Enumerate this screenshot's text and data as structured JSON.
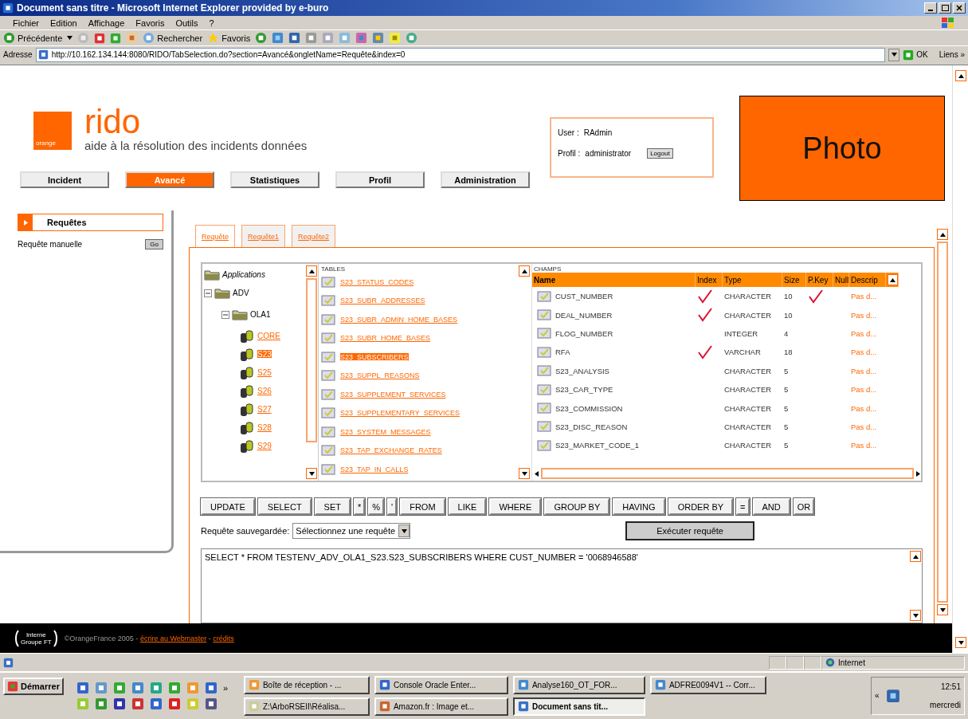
{
  "window": {
    "title": "Document sans titre - Microsoft Internet Explorer provided by e-buro"
  },
  "menu": [
    "Fichier",
    "Edition",
    "Affichage",
    "Favoris",
    "Outils",
    "?"
  ],
  "toolbar": {
    "back": "Précédente",
    "search": "Rechercher",
    "favorites": "Favoris"
  },
  "address": {
    "label": "Adresse",
    "url": "http://10.162.134.144:8080/RIDO/TabSelection.do?section=Avancé&ongletName=Requête&index=0",
    "go": "OK",
    "links": "Liens »"
  },
  "header": {
    "logo": "orange",
    "brand": "rido",
    "tagline": "aide à la résolution des incidents données",
    "user_label": "User :",
    "user": "RAdmin",
    "profile_label": "Profil :",
    "profile": "administrator",
    "logout": "Logout",
    "photo": "Photo"
  },
  "nav": [
    {
      "label": "Incident",
      "selected": false
    },
    {
      "label": "Avancé",
      "selected": true
    },
    {
      "label": "Statistiques",
      "selected": false
    },
    {
      "label": "Profil",
      "selected": false
    },
    {
      "label": "Administration",
      "selected": false
    }
  ],
  "sidebar": {
    "title": "Requêtes",
    "items": [
      {
        "label": "Requête manuelle",
        "button": "Go"
      }
    ]
  },
  "tabs": [
    {
      "label": "Requête",
      "selected": true
    },
    {
      "label": "Requête1",
      "selected": false
    },
    {
      "label": "Requête2",
      "selected": false
    }
  ],
  "tree": [
    {
      "label": "Applications",
      "kind": "root",
      "children": [
        {
          "label": "ADV",
          "kind": "folder",
          "expanded": true,
          "children": [
            {
              "label": "OLA1",
              "kind": "folder",
              "expanded": true,
              "children": [
                {
                  "label": "CORE",
                  "kind": "schema",
                  "selected": false
                },
                {
                  "label": "S23",
                  "kind": "schema",
                  "selected": true
                },
                {
                  "label": "S25",
                  "kind": "schema",
                  "selected": false
                },
                {
                  "label": "S26",
                  "kind": "schema",
                  "selected": false
                },
                {
                  "label": "S27",
                  "kind": "schema",
                  "selected": false
                },
                {
                  "label": "S28",
                  "kind": "schema",
                  "selected": false
                },
                {
                  "label": "S29",
                  "kind": "schema",
                  "selected": false
                }
              ]
            }
          ]
        }
      ]
    }
  ],
  "tables": {
    "title": "TABLES",
    "rows": [
      {
        "label": "S23_STATUS_CODES",
        "selected": false
      },
      {
        "label": "S23_SUBR_ADDRESSES",
        "selected": false
      },
      {
        "label": "S23_SUBR_ADMIN_HOME_BASES",
        "selected": false
      },
      {
        "label": "S23_SUBR_HOME_BASES",
        "selected": false
      },
      {
        "label": "S23_SUBSCRIBERS",
        "selected": true
      },
      {
        "label": "S23_SUPPL_REASONS",
        "selected": false
      },
      {
        "label": "S23_SUPPLEMENT_SERVICES",
        "selected": false
      },
      {
        "label": "S23_SUPPLEMENTARY_SERVICES",
        "selected": false
      },
      {
        "label": "S23_SYSTEM_MESSAGES",
        "selected": false
      },
      {
        "label": "S23_TAP_EXCHANGE_RATES",
        "selected": false
      },
      {
        "label": "S23_TAP_IN_CALLS",
        "selected": false
      }
    ]
  },
  "fields": {
    "title": "CHAMPS",
    "columns": [
      "Name",
      "Index",
      "Type",
      "Size",
      "P.Key",
      "Null",
      "Descrip"
    ],
    "rows": [
      {
        "name": "CUST_NUMBER",
        "index": true,
        "type": "CHARACTER",
        "size": "10",
        "pkey": true,
        "description": "Pas d..."
      },
      {
        "name": "DEAL_NUMBER",
        "index": true,
        "type": "CHARACTER",
        "size": "10",
        "pkey": false,
        "description": "Pas d..."
      },
      {
        "name": "FLOG_NUMBER",
        "index": false,
        "type": "INTEGER",
        "size": "4",
        "pkey": false,
        "description": "Pas d..."
      },
      {
        "name": "RFA",
        "index": true,
        "type": "VARCHAR",
        "size": "18",
        "pkey": false,
        "description": "Pas d..."
      },
      {
        "name": "S23_ANALYSIS",
        "index": false,
        "type": "CHARACTER",
        "size": "5",
        "pkey": false,
        "description": "Pas d..."
      },
      {
        "name": "S23_CAR_TYPE",
        "index": false,
        "type": "CHARACTER",
        "size": "5",
        "pkey": false,
        "description": "Pas d..."
      },
      {
        "name": "S23_COMMISSION",
        "index": false,
        "type": "CHARACTER",
        "size": "5",
        "pkey": false,
        "description": "Pas d..."
      },
      {
        "name": "S23_DISC_REASON",
        "index": false,
        "type": "CHARACTER",
        "size": "5",
        "pkey": false,
        "description": "Pas d..."
      },
      {
        "name": "S23_MARKET_CODE_1",
        "index": false,
        "type": "CHARACTER",
        "size": "5",
        "pkey": false,
        "description": "Pas d..."
      }
    ]
  },
  "sql_buttons": [
    "UPDATE",
    "SELECT",
    "SET",
    "*",
    "%",
    "'",
    "FROM",
    "LIKE",
    "WHERE",
    "GROUP BY",
    "HAVING",
    "ORDER BY",
    "=",
    "AND",
    "OR"
  ],
  "saved_query": {
    "label": "Requête sauvegardée:",
    "value": "Sélectionnez une requête"
  },
  "execute": "Exécuter requête",
  "query": "SELECT * FROM TESTENV_ADV_OLA1_S23.S23_SUBSCRIBERS WHERE CUST_NUMBER  = '0068946588'",
  "footer": {
    "badge_top": "Interne",
    "badge_bottom": "Groupe FT",
    "notice": "©OrangeFrance 2005 -",
    "links": [
      "écrire au Webmaster",
      "crédits"
    ],
    "separator": "-"
  },
  "status_bar": {
    "zone": "Internet"
  },
  "taskbar": {
    "start": "Démarrer",
    "more": "»",
    "tasks": [
      {
        "label": "Boîte de réception - ...",
        "active": false
      },
      {
        "label": "Console Oracle Enter...",
        "active": false
      },
      {
        "label": "Analyse160_OT_FOR...",
        "active": false
      },
      {
        "label": "ADFRE0094V1 -- Corr...",
        "active": false
      },
      {
        "label": "Z:\\ArboRSEII\\Réalisa...",
        "active": false
      },
      {
        "label": "Amazon.fr : Image et...",
        "active": false
      },
      {
        "label": "Document sans tit...",
        "active": true
      }
    ],
    "tray_more": "«",
    "time": "12:51",
    "day": "mercredi"
  }
}
